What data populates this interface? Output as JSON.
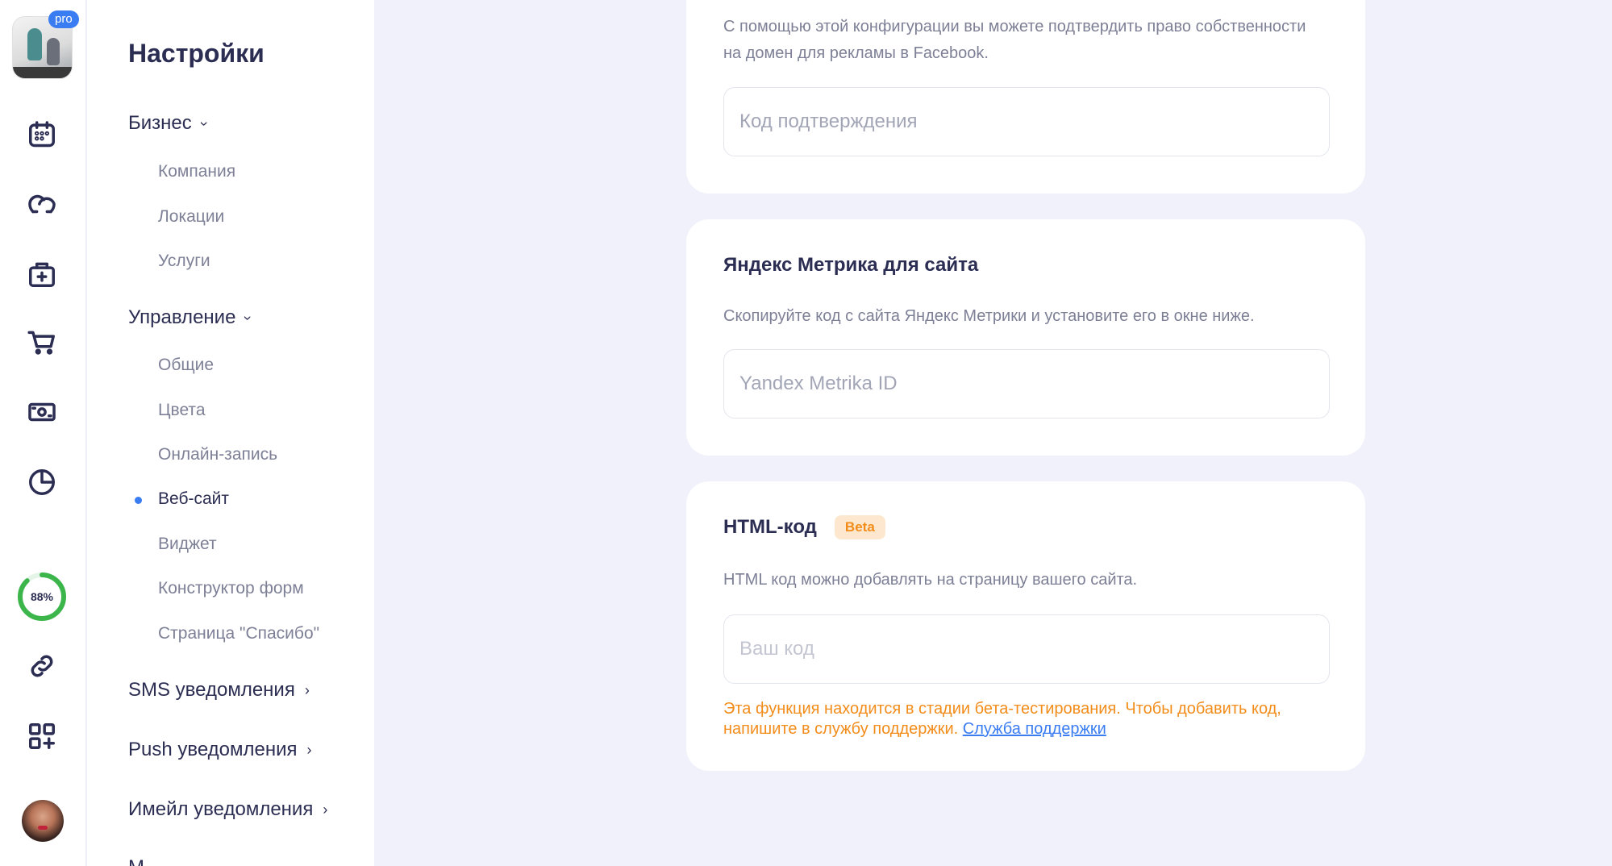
{
  "rail": {
    "pro_badge": "pro",
    "progress": {
      "value": 88,
      "label": "88%"
    },
    "icons": [
      "calendar-icon",
      "clients-icon",
      "services-bag-icon",
      "cart-icon",
      "money-icon",
      "analytics-icon",
      "link-icon",
      "apps-add-icon"
    ]
  },
  "settings": {
    "title": "Настройки",
    "sections": {
      "business": {
        "label": "Бизнес",
        "items": [
          "Компания",
          "Локации",
          "Услуги"
        ]
      },
      "management": {
        "label": "Управление",
        "items": [
          "Общие",
          "Цвета",
          "Онлайн-запись",
          "Веб-сайт",
          "Виджет",
          "Конструктор форм",
          "Страница \"Спасибо\""
        ]
      },
      "sms": {
        "label": "SMS уведомления"
      },
      "push": {
        "label": "Push уведомления"
      },
      "email": {
        "label": "Имейл уведомления"
      },
      "cut_off": {
        "label": "М"
      }
    }
  },
  "facebook_card": {
    "description": "С помощью этой конфигурации вы можете подтвердить право собственности на домен для рекламы в Facebook.",
    "placeholder": "Код подтверждения"
  },
  "yandex_card": {
    "title": "Яндекс Метрика для сайта",
    "description": "Скопируйте код с сайта Яндекс Метрики и установите его в окне ниже.",
    "placeholder": "Yandex Metrika ID"
  },
  "html_card": {
    "title": "HTML-код",
    "badge": "Beta",
    "description": "HTML код можно добавлять на страницу вашего сайта.",
    "placeholder": "Ваш код",
    "warning": "Эта функция находится в стадии бета-тестирования. Чтобы добавить код, напишите в службу поддержки.",
    "support_link": "Служба поддержки"
  },
  "colors": {
    "accent": "#3a7cf2",
    "progress": "#3cb54a",
    "warning": "#f28c1a",
    "background": "#f0f1fa"
  }
}
